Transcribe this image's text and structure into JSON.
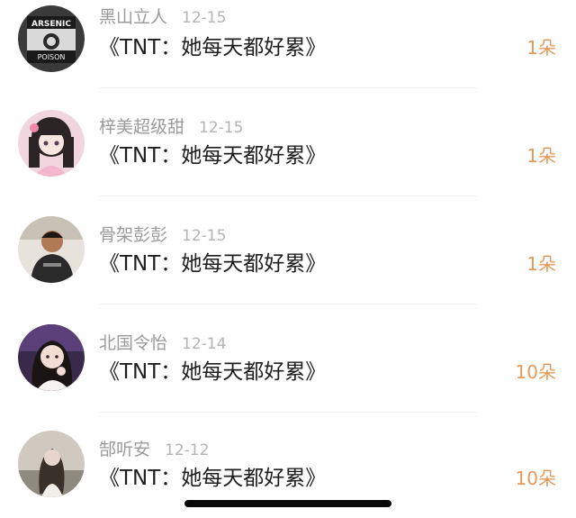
{
  "items": [
    {
      "username": "黑山立人",
      "date": "12-15",
      "title": "《TNT：她每天都好累》",
      "amount": "1朵",
      "avatar_text": [
        "ARSENIC",
        "POISON"
      ]
    },
    {
      "username": "梓美超级甜",
      "date": "12-15",
      "title": "《TNT：她每天都好累》",
      "amount": "1朵"
    },
    {
      "username": "骨架彭彭",
      "date": "12-15",
      "title": "《TNT：她每天都好累》",
      "amount": "1朵"
    },
    {
      "username": "北国令怡",
      "date": "12-14",
      "title": "《TNT：她每天都好累》",
      "amount": "10朵"
    },
    {
      "username": "郜听安",
      "date": "12-12",
      "title": "《TNT：她每天都好累》",
      "amount": "10朵"
    }
  ],
  "colors": {
    "amount": "#e39a5a",
    "username": "#9a9a9a",
    "date": "#b4b4b4",
    "title": "#1e1e1e",
    "divider": "#efefef"
  }
}
